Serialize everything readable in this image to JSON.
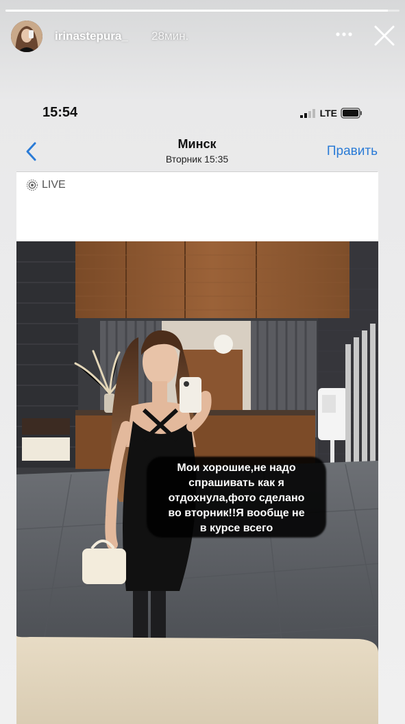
{
  "story": {
    "username": "irinastepura_",
    "time_ago": "28мин.",
    "progress": 0.97,
    "caption_lines": [
      "Мои хорошие,не надо",
      "спрашивать как я",
      "отдохнула,фото сделано",
      "во вторник!!Я вообще не",
      "в курсе всего"
    ]
  },
  "icons": {
    "more": "more-horizontal-icon",
    "close": "close-icon",
    "back": "chevron-left-icon",
    "live": "live-photo-icon"
  },
  "phone_screen": {
    "time": "15:54",
    "network": "LTE",
    "nav_title": "Минск",
    "nav_subtitle": "Вторник  15:35",
    "edit_label": "Править",
    "live_label": "LIVE"
  },
  "colors": {
    "accent": "#2a7bd6",
    "caption_bg": "#000000"
  }
}
